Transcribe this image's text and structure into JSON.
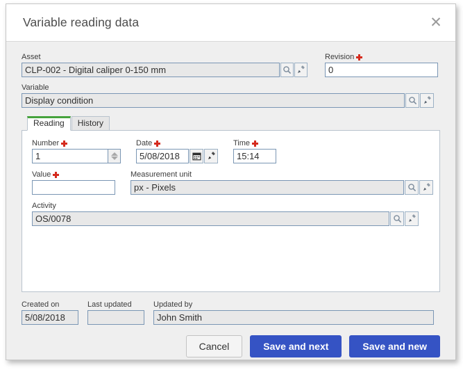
{
  "dialog": {
    "title": "Variable reading data",
    "close_icon": "close-icon"
  },
  "form": {
    "asset": {
      "label": "Asset",
      "value": "CLP-002 - Digital caliper 0-150 mm",
      "required": false,
      "readonly": true,
      "search_icon": "search-icon",
      "clear_icon": "brush-icon"
    },
    "revision": {
      "label": "Revision",
      "value": "0",
      "required": true,
      "readonly": false
    },
    "variable": {
      "label": "Variable",
      "value": "Display condition",
      "required": false,
      "readonly": true,
      "search_icon": "search-icon",
      "clear_icon": "brush-icon"
    }
  },
  "tabs": {
    "items": [
      {
        "label": "Reading",
        "active": true
      },
      {
        "label": "History",
        "active": false
      }
    ],
    "reading": {
      "number": {
        "label": "Number",
        "value": "1",
        "required": true,
        "spinner_up_icon": "caret-up-icon",
        "spinner_down_icon": "caret-down-icon"
      },
      "date": {
        "label": "Date",
        "value": "5/08/2018",
        "required": true,
        "calendar_icon": "calendar-icon",
        "clear_icon": "brush-icon"
      },
      "time": {
        "label": "Time",
        "value": "15:14",
        "required": true
      },
      "value": {
        "label": "Value",
        "value": "",
        "required": true
      },
      "measurement_unit": {
        "label": "Measurement unit",
        "value": "px - Pixels",
        "required": false,
        "readonly": true,
        "search_icon": "search-icon",
        "clear_icon": "brush-icon"
      },
      "activity": {
        "label": "Activity",
        "value": "OS/0078",
        "required": false,
        "readonly": true,
        "search_icon": "search-icon",
        "clear_icon": "brush-icon"
      }
    }
  },
  "meta": {
    "created_on": {
      "label": "Created on",
      "value": "5/08/2018"
    },
    "last_updated": {
      "label": "Last updated",
      "value": ""
    },
    "updated_by": {
      "label": "Updated by",
      "value": "John Smith"
    }
  },
  "footer": {
    "cancel": "Cancel",
    "save_and_next": "Save and next",
    "save_and_new": "Save and new"
  },
  "colors": {
    "primary_button": "#3553c4",
    "active_tab_accent": "#46a33c",
    "required_marker": "#d52b1e",
    "dialog_background": "#efefef"
  }
}
